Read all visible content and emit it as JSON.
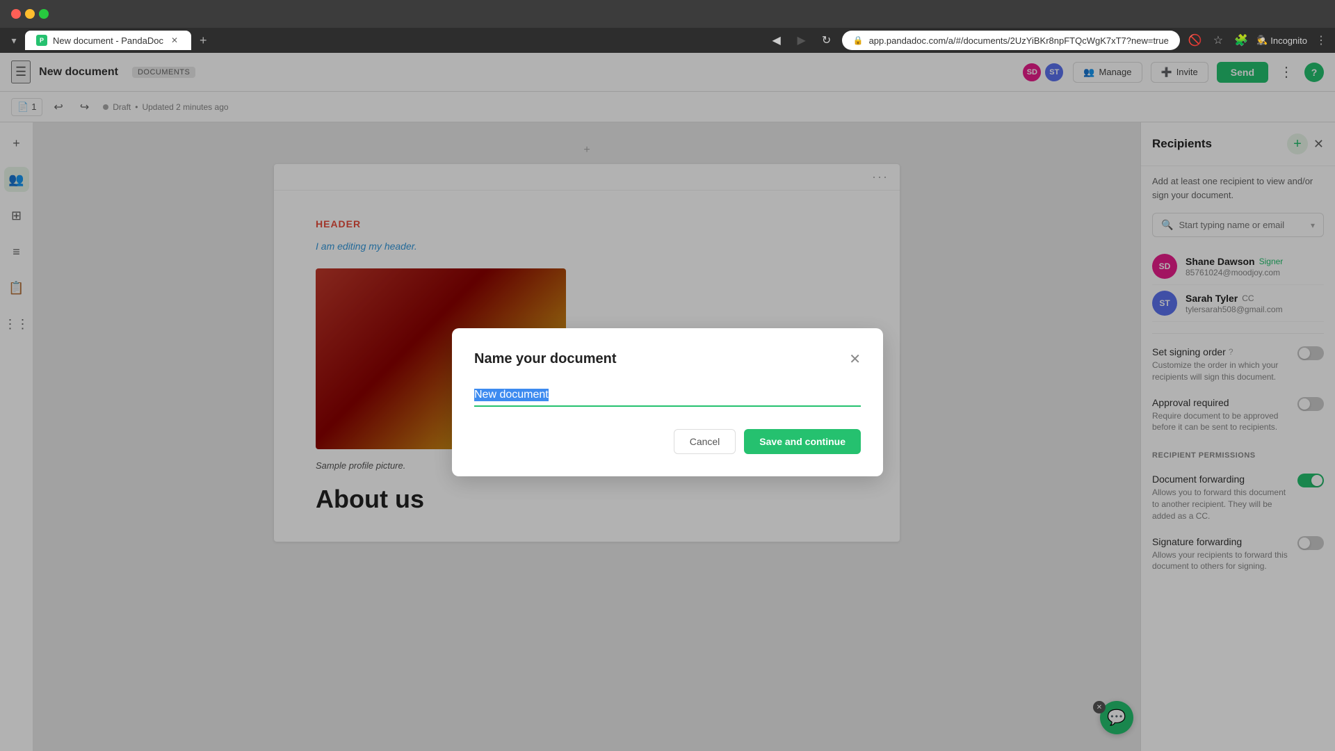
{
  "browser": {
    "tab_title": "New document - PandaDoc",
    "url": "app.pandadoc.com/a/#/documents/2UzYiBKr8npFTQcWgK7xT7?new=true",
    "incognito_label": "Incognito"
  },
  "header": {
    "menu_icon": "☰",
    "doc_title": "New document",
    "doc_badge": "DOCUMENTS",
    "subtitle_status": "Draft",
    "subtitle_time": "Updated 2 minutes ago",
    "manage_label": "Manage",
    "invite_label": "Invite",
    "send_label": "Send"
  },
  "toolbar": {
    "page_number": "1",
    "undo_icon": "↩",
    "redo_icon": "↪"
  },
  "document": {
    "add_section_plus": "+",
    "more_dots": "···",
    "header_label": "HEADER",
    "header_text": "I am editing my header.",
    "image_caption": "Sample profile picture.",
    "about_us_title": "About us"
  },
  "right_panel": {
    "title": "Recipients",
    "description": "Add at least one recipient to view and/or sign your document.",
    "search_placeholder": "Start typing name or email",
    "recipients": [
      {
        "initials": "SD",
        "name": "Shane Dawson",
        "role": "Signer",
        "email": "85761024@moodjoy.com",
        "avatar_color": "#e91e8c"
      },
      {
        "initials": "ST",
        "name": "Sarah Tyler",
        "role": "CC",
        "email": "tylersarah508@gmail.com",
        "avatar_color": "#5b72ee"
      }
    ],
    "signing_order_label": "Set signing order",
    "signing_order_desc": "Customize the order in which your recipients will sign this document.",
    "signing_order_state": "off",
    "approval_required_label": "Approval required",
    "approval_required_desc": "Require document to be approved before it can be sent to recipients.",
    "approval_required_state": "off",
    "permissions_label": "RECIPIENT PERMISSIONS",
    "doc_forwarding_label": "Document forwarding",
    "doc_forwarding_desc": "Allows you to forward this document to another recipient. They will be added as a CC.",
    "doc_forwarding_state": "on",
    "sig_forwarding_label": "Signature forwarding",
    "sig_forwarding_desc": "Allows your recipients to forward this document to others for signing.",
    "sig_forwarding_state": "off"
  },
  "modal": {
    "title": "Name your document",
    "input_value": "New document",
    "cancel_label": "Cancel",
    "save_label": "Save and continue"
  },
  "icons": {
    "close": "✕",
    "add": "+",
    "search": "🔍",
    "manage_users": "👥",
    "add_user": "➕",
    "chevron_down": "▾",
    "info": "?",
    "chat": "💬"
  }
}
